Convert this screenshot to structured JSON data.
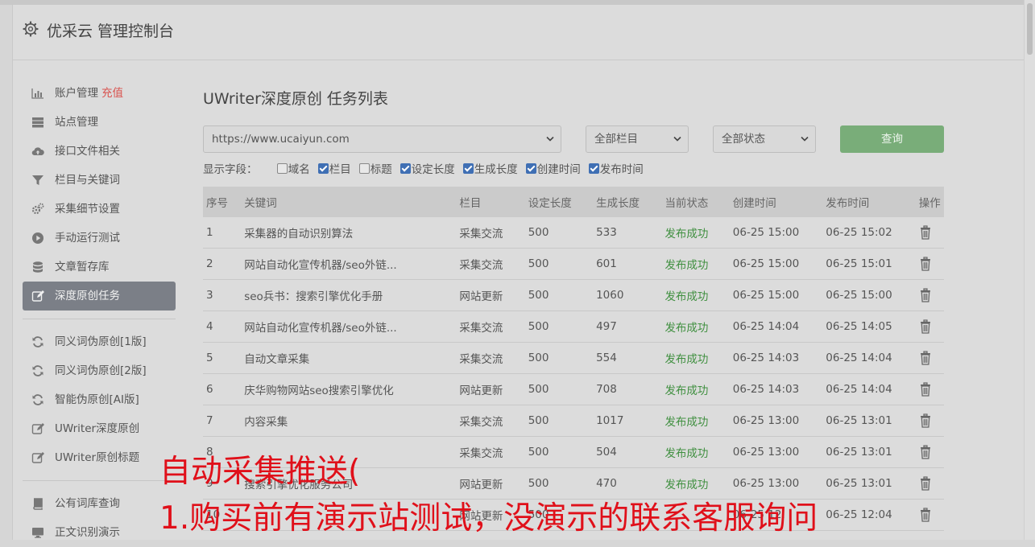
{
  "header": {
    "title": "优采云 管理控制台"
  },
  "sidebar": {
    "items": [
      {
        "label": "账户管理",
        "badge": "充值",
        "icon": "bar-chart-icon"
      },
      {
        "label": "站点管理",
        "icon": "server-icon"
      },
      {
        "label": "接口文件相关",
        "icon": "cloud-upload-icon"
      },
      {
        "label": "栏目与关键词",
        "icon": "filter-icon"
      },
      {
        "label": "采集细节设置",
        "icon": "gears-icon"
      },
      {
        "label": "手动运行测试",
        "icon": "play-icon"
      },
      {
        "label": "文章暂存库",
        "icon": "database-icon"
      },
      {
        "label": "深度原创任务",
        "icon": "edit-icon",
        "active": true
      },
      {
        "label": "同义词伪原创[1版]",
        "icon": "refresh-icon"
      },
      {
        "label": "同义词伪原创[2版]",
        "icon": "refresh-icon"
      },
      {
        "label": "智能伪原创[AI版]",
        "icon": "refresh-icon"
      },
      {
        "label": "UWriter深度原创",
        "icon": "edit-icon"
      },
      {
        "label": "UWriter原创标题",
        "icon": "edit-icon"
      },
      {
        "label": "公有词库查询",
        "icon": "book-icon"
      },
      {
        "label": "正文识别演示",
        "icon": "monitor-icon"
      }
    ]
  },
  "main": {
    "title": "UWriter深度原创 任务列表",
    "filters": {
      "site": "https://www.ucaiyun.com",
      "column": "全部栏目",
      "status": "全部状态",
      "query_label": "查询"
    },
    "fields": {
      "label": "显示字段：",
      "options": [
        {
          "label": "域名",
          "checked": false
        },
        {
          "label": "栏目",
          "checked": true
        },
        {
          "label": "标题",
          "checked": false
        },
        {
          "label": "设定长度",
          "checked": true
        },
        {
          "label": "生成长度",
          "checked": true
        },
        {
          "label": "创建时间",
          "checked": true
        },
        {
          "label": "发布时间",
          "checked": true
        }
      ]
    },
    "table": {
      "headers": [
        "序号",
        "关键词",
        "栏目",
        "设定长度",
        "生成长度",
        "当前状态",
        "创建时间",
        "发布时间",
        "操作"
      ],
      "rows": [
        [
          "1",
          "采集器的自动识别算法",
          "采集交流",
          "500",
          "533",
          "发布成功",
          "06-25 15:00",
          "06-25 15:02"
        ],
        [
          "2",
          "网站自动化宣传机器/seo外链...",
          "采集交流",
          "500",
          "601",
          "发布成功",
          "06-25 15:00",
          "06-25 15:01"
        ],
        [
          "3",
          "seo兵书：搜索引擎优化手册",
          "网站更新",
          "500",
          "1060",
          "发布成功",
          "06-25 15:00",
          "06-25 15:00"
        ],
        [
          "4",
          "网站自动化宣传机器/seo外链...",
          "采集交流",
          "500",
          "497",
          "发布成功",
          "06-25 14:04",
          "06-25 14:05"
        ],
        [
          "5",
          "自动文章采集",
          "采集交流",
          "500",
          "554",
          "发布成功",
          "06-25 14:03",
          "06-25 14:04"
        ],
        [
          "6",
          "庆华购物网站seo搜索引擎优化",
          "网站更新",
          "500",
          "708",
          "发布成功",
          "06-25 14:03",
          "06-25 14:04"
        ],
        [
          "7",
          "内容采集",
          "采集交流",
          "500",
          "1017",
          "发布成功",
          "06-25 13:00",
          "06-25 13:01"
        ],
        [
          "8",
          "",
          "采集交流",
          "500",
          "504",
          "发布成功",
          "06-25 13:00",
          "06-25 13:01"
        ],
        [
          "9",
          "搜索引擎优化服务公司",
          "网站更新",
          "500",
          "470",
          "发布成功",
          "06-25 13:00",
          "06-25 13:01"
        ],
        [
          "10",
          "",
          "网站更新",
          "500",
          "",
          "",
          "06-25 12:",
          "06-25 12:04"
        ]
      ]
    }
  },
  "overlay": {
    "line1": "自动采集推送(",
    "line2": "1.购买前有演示站测试，没演示的联系客服询问"
  },
  "colors": {
    "success": "#3f8f3f",
    "accent_button": "#79ad79",
    "badge": "#d9534f",
    "overlay_text": "#e0101a"
  }
}
